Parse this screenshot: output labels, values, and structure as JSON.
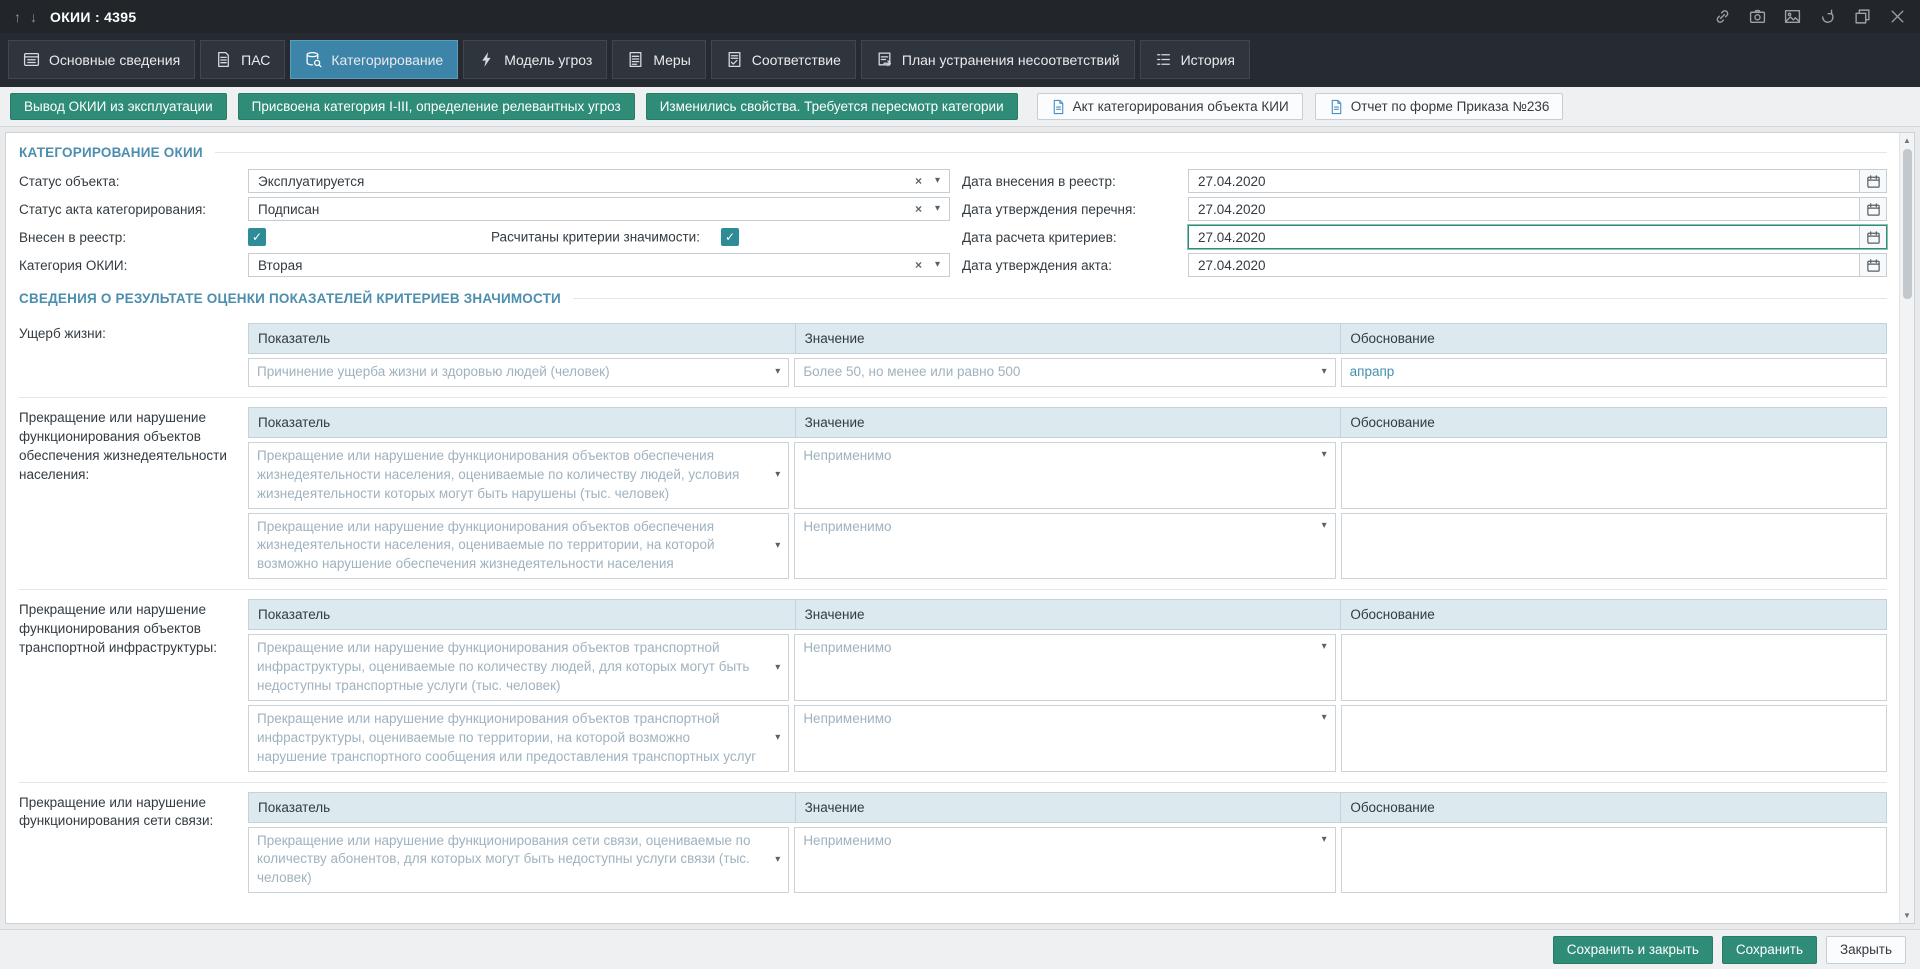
{
  "colors": {
    "accent_teal": "#2F8C77",
    "accent_blue_tab": "#3C84A8",
    "checkbox_teal": "#2E8C96",
    "section_title_blue": "#4C8EAE",
    "table_header_bg": "#DCE9EF",
    "titlebar_bg": "#22262B",
    "muted_dropdown_text": "#9FB2BF",
    "justification_text": "#4591AD"
  },
  "glyphs": {
    "up_arrow": "↑",
    "down_arrow": "↓",
    "clear": "×",
    "chevron": "▾",
    "check": "✓",
    "scroll_up": "▲",
    "scroll_down": "▼"
  },
  "titlebar": {
    "title": "ОКИИ : 4395"
  },
  "tabs": [
    {
      "label": "Основные сведения"
    },
    {
      "label": "ПАС"
    },
    {
      "label": "Категорирование"
    },
    {
      "label": "Модель угроз"
    },
    {
      "label": "Меры"
    },
    {
      "label": "Соответствие"
    },
    {
      "label": "План устранения несоответствий"
    },
    {
      "label": "История"
    }
  ],
  "toolbar": {
    "action_buttons": [
      {
        "label": "Вывод ОКИИ из эксплуатации"
      },
      {
        "label": "Присвоена категория I-III, определение релевантных угроз"
      },
      {
        "label": "Изменились свойства. Требуется пересмотр категории"
      }
    ],
    "report_buttons": [
      {
        "label": "Акт категорирования объекта КИИ"
      },
      {
        "label": "Отчет по форме Приказа №236"
      }
    ]
  },
  "categorization": {
    "section_title": "КАТЕГОРИРОВАНИЕ ОКИИ",
    "object_status": {
      "label": "Статус объекта:",
      "value": "Эксплуатируется"
    },
    "act_status": {
      "label": "Статус акта категорирования:",
      "value": "Подписан"
    },
    "in_registry": {
      "label": "Внесен в реестр:",
      "checked": true
    },
    "criteria_calculated": {
      "label": "Расчитаны критерии значимости:",
      "checked": true
    },
    "category": {
      "label": "Категория ОКИИ:",
      "value": "Вторая"
    },
    "date_registry": {
      "label": "Дата внесения в реестр:",
      "value": "27.04.2020"
    },
    "date_list_approved": {
      "label": "Дата утверждения перечня:",
      "value": "27.04.2020"
    },
    "date_criteria_calc": {
      "label": "Дата расчета критериев:",
      "value": "27.04.2020"
    },
    "date_act_approved": {
      "label": "Дата утверждения акта:",
      "value": "27.04.2020"
    }
  },
  "criteria": {
    "section_title": "СВЕДЕНИЯ О РЕЗУЛЬТАТЕ ОЦЕНКИ ПОКАЗАТЕЛЕЙ КРИТЕРИЕВ ЗНАЧИМОСТИ",
    "columns": {
      "indicator": "Показатель",
      "value": "Значение",
      "justification": "Обоснование"
    },
    "groups": [
      {
        "label": "Ущерб жизни:",
        "rows": [
          {
            "indicator": "Причинение ущерба жизни и здоровью людей (человек)",
            "value": "Более 50, но менее или равно 500",
            "justification": "апрапр"
          }
        ]
      },
      {
        "label": "Прекращение или нарушение функционирования объектов обеспечения жизнедеятельности населения:",
        "rows": [
          {
            "indicator": "Прекращение или нарушение функционирования объектов обеспечения жизнедеятельности населения, оцениваемые по количеству людей, условия жизнедеятельности которых могут быть нарушены (тыс. человек)",
            "value": "Неприменимо",
            "justification": ""
          },
          {
            "indicator": "Прекращение или нарушение функционирования объектов обеспечения жизнедеятельности населения, оцениваемые по территории, на которой возможно нарушение обеспечения жизнедеятельности населения",
            "value": "Неприменимо",
            "justification": ""
          }
        ]
      },
      {
        "label": "Прекращение или нарушение функционирования объектов транспортной инфраструктуры:",
        "rows": [
          {
            "indicator": "Прекращение или нарушение функционирования объектов транспортной инфраструктуры, оцениваемые по количеству людей, для которых могут быть недоступны транспортные услуги (тыс. человек)",
            "value": "Неприменимо",
            "justification": ""
          },
          {
            "indicator": "Прекращение или нарушение функционирования объектов транспортной инфраструктуры, оцениваемые по территории, на которой возможно нарушение транспортного сообщения или предоставления транспортных услуг",
            "value": "Неприменимо",
            "justification": ""
          }
        ]
      },
      {
        "label": "Прекращение или нарушение функционирования сети связи:",
        "rows": [
          {
            "indicator": "Прекращение или нарушение функционирования сети связи, оцениваемые по количеству абонентов, для которых могут быть недоступны услуги связи (тыс. человек)",
            "value": "Неприменимо",
            "justification": ""
          }
        ]
      }
    ]
  },
  "footer": {
    "save_and_close": "Сохранить и закрыть",
    "save": "Сохранить",
    "close": "Закрыть"
  }
}
